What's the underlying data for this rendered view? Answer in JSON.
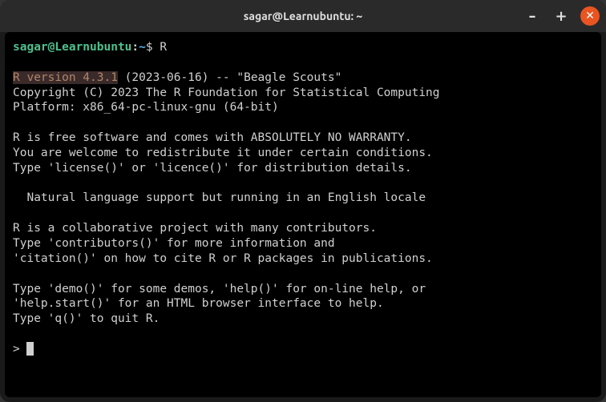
{
  "window": {
    "title": "sagar@Learnubuntu: ~"
  },
  "prompt": {
    "user_host": "sagar@Learnubuntu",
    "path": "~",
    "command": "R"
  },
  "r_startup": {
    "version_highlight": "R version 4.3.1",
    "version_rest": " (2023-06-16) -- \"Beagle Scouts\"",
    "copyright": "Copyright (C) 2023 The R Foundation for Statistical Computing",
    "platform": "Platform: x86_64-pc-linux-gnu (64-bit)",
    "warranty1": "R is free software and comes with ABSOLUTELY NO WARRANTY.",
    "warranty2": "You are welcome to redistribute it under certain conditions.",
    "warranty3": "Type 'license()' or 'licence()' for distribution details.",
    "locale": "  Natural language support but running in an English locale",
    "collab1": "R is a collaborative project with many contributors.",
    "collab2": "Type 'contributors()' for more information and",
    "collab3": "'citation()' on how to cite R or R packages in publications.",
    "help1": "Type 'demo()' for some demos, 'help()' for on-line help, or",
    "help2": "'help.start()' for an HTML browser interface to help.",
    "quit": "Type 'q()' to quit R.",
    "r_prompt": "> "
  }
}
